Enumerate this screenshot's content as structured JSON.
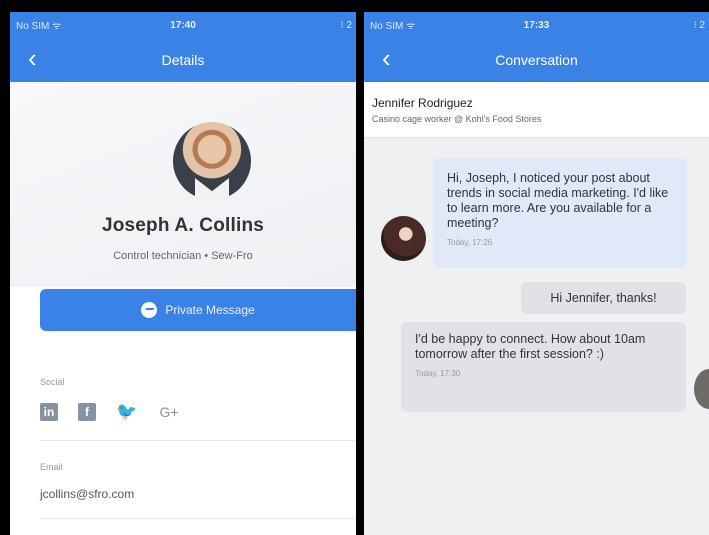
{
  "left_screen": {
    "status": {
      "carrier": "No SIM ᯤ",
      "time": "17:40",
      "battery": "⁝ 2"
    },
    "nav": {
      "title": "Details",
      "back_glyph": "‹"
    },
    "profile": {
      "name": "Joseph A. Collins",
      "role": "Control technician • Sew-Fro"
    },
    "private_message_label": "Private Message",
    "social": {
      "label": "Social",
      "icons": [
        "in",
        "f",
        "🐦",
        "G+"
      ]
    },
    "email": {
      "label": "Email",
      "value": "jcollins@sfro.com"
    }
  },
  "right_screen": {
    "status": {
      "carrier": "No SIM ᯤ",
      "time": "17:33",
      "battery": "⁝ 2"
    },
    "nav": {
      "title": "Conversation",
      "back_glyph": "‹"
    },
    "contact": {
      "name": "Jennifer Rodriguez",
      "job": "Casino cage worker @ Kohl's Food Stores"
    },
    "messages": [
      {
        "text": "Hi, Joseph, I noticed your post about trends in social media marketing. I'd like to learn more. Are you available for a meeting?",
        "time": "Today, 17:26"
      },
      {
        "text": "Hi Jennifer, thanks!",
        "time": ""
      },
      {
        "text": "I'd be happy to connect. How about 10am tomorrow after the first session? :)",
        "time": "Today, 17:30"
      }
    ]
  },
  "colors": {
    "accent": "#3b82e6",
    "incoming_bubble": "#dfe9f7",
    "outgoing_bubble": "#e0e2e6"
  }
}
